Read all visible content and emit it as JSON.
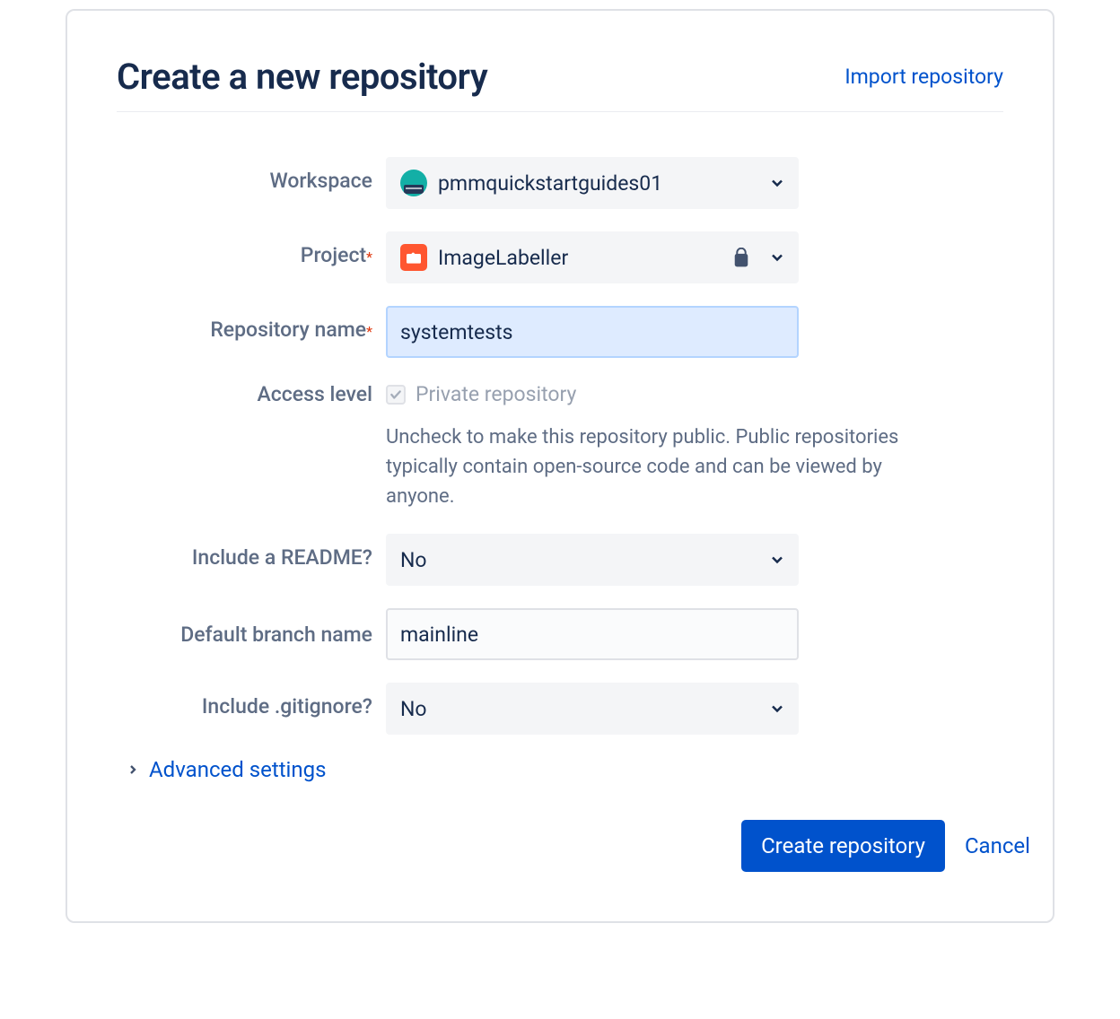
{
  "header": {
    "title": "Create a new repository",
    "import_link": "Import repository"
  },
  "form": {
    "workspace": {
      "label": "Workspace",
      "value": "pmmquickstartguides01"
    },
    "project": {
      "label": "Project",
      "value": "ImageLabeller",
      "required": true
    },
    "repo_name": {
      "label": "Repository name",
      "value": "systemtests",
      "required": true
    },
    "access": {
      "label": "Access level",
      "checkbox_label": "Private repository",
      "checked": true,
      "helper": "Uncheck to make this repository public. Public repositories typically contain open-source code and can be viewed by anyone."
    },
    "readme": {
      "label": "Include a README?",
      "value": "No"
    },
    "default_branch": {
      "label": "Default branch name",
      "value": "mainline"
    },
    "gitignore": {
      "label": "Include .gitignore?",
      "value": "No"
    },
    "advanced": "Advanced settings"
  },
  "actions": {
    "create": "Create repository",
    "cancel": "Cancel"
  }
}
